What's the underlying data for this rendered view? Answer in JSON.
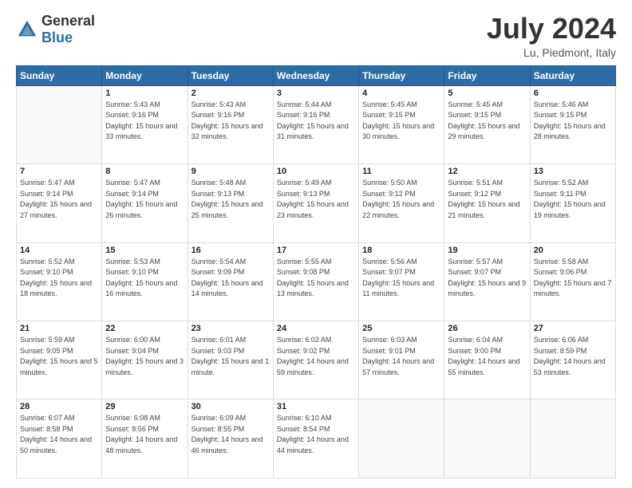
{
  "logo": {
    "general": "General",
    "blue": "Blue"
  },
  "title": {
    "month": "July 2024",
    "location": "Lu, Piedmont, Italy"
  },
  "weekdays": [
    "Sunday",
    "Monday",
    "Tuesday",
    "Wednesday",
    "Thursday",
    "Friday",
    "Saturday"
  ],
  "weeks": [
    [
      {
        "day": "",
        "sunrise": "",
        "sunset": "",
        "daylight": ""
      },
      {
        "day": "1",
        "sunrise": "Sunrise: 5:43 AM",
        "sunset": "Sunset: 9:16 PM",
        "daylight": "Daylight: 15 hours and 33 minutes."
      },
      {
        "day": "2",
        "sunrise": "Sunrise: 5:43 AM",
        "sunset": "Sunset: 9:16 PM",
        "daylight": "Daylight: 15 hours and 32 minutes."
      },
      {
        "day": "3",
        "sunrise": "Sunrise: 5:44 AM",
        "sunset": "Sunset: 9:16 PM",
        "daylight": "Daylight: 15 hours and 31 minutes."
      },
      {
        "day": "4",
        "sunrise": "Sunrise: 5:45 AM",
        "sunset": "Sunset: 9:15 PM",
        "daylight": "Daylight: 15 hours and 30 minutes."
      },
      {
        "day": "5",
        "sunrise": "Sunrise: 5:45 AM",
        "sunset": "Sunset: 9:15 PM",
        "daylight": "Daylight: 15 hours and 29 minutes."
      },
      {
        "day": "6",
        "sunrise": "Sunrise: 5:46 AM",
        "sunset": "Sunset: 9:15 PM",
        "daylight": "Daylight: 15 hours and 28 minutes."
      }
    ],
    [
      {
        "day": "7",
        "sunrise": "Sunrise: 5:47 AM",
        "sunset": "Sunset: 9:14 PM",
        "daylight": "Daylight: 15 hours and 27 minutes."
      },
      {
        "day": "8",
        "sunrise": "Sunrise: 5:47 AM",
        "sunset": "Sunset: 9:14 PM",
        "daylight": "Daylight: 15 hours and 26 minutes."
      },
      {
        "day": "9",
        "sunrise": "Sunrise: 5:48 AM",
        "sunset": "Sunset: 9:13 PM",
        "daylight": "Daylight: 15 hours and 25 minutes."
      },
      {
        "day": "10",
        "sunrise": "Sunrise: 5:49 AM",
        "sunset": "Sunset: 9:13 PM",
        "daylight": "Daylight: 15 hours and 23 minutes."
      },
      {
        "day": "11",
        "sunrise": "Sunrise: 5:50 AM",
        "sunset": "Sunset: 9:12 PM",
        "daylight": "Daylight: 15 hours and 22 minutes."
      },
      {
        "day": "12",
        "sunrise": "Sunrise: 5:51 AM",
        "sunset": "Sunset: 9:12 PM",
        "daylight": "Daylight: 15 hours and 21 minutes."
      },
      {
        "day": "13",
        "sunrise": "Sunrise: 5:52 AM",
        "sunset": "Sunset: 9:11 PM",
        "daylight": "Daylight: 15 hours and 19 minutes."
      }
    ],
    [
      {
        "day": "14",
        "sunrise": "Sunrise: 5:52 AM",
        "sunset": "Sunset: 9:10 PM",
        "daylight": "Daylight: 15 hours and 18 minutes."
      },
      {
        "day": "15",
        "sunrise": "Sunrise: 5:53 AM",
        "sunset": "Sunset: 9:10 PM",
        "daylight": "Daylight: 15 hours and 16 minutes."
      },
      {
        "day": "16",
        "sunrise": "Sunrise: 5:54 AM",
        "sunset": "Sunset: 9:09 PM",
        "daylight": "Daylight: 15 hours and 14 minutes."
      },
      {
        "day": "17",
        "sunrise": "Sunrise: 5:55 AM",
        "sunset": "Sunset: 9:08 PM",
        "daylight": "Daylight: 15 hours and 13 minutes."
      },
      {
        "day": "18",
        "sunrise": "Sunrise: 5:56 AM",
        "sunset": "Sunset: 9:07 PM",
        "daylight": "Daylight: 15 hours and 11 minutes."
      },
      {
        "day": "19",
        "sunrise": "Sunrise: 5:57 AM",
        "sunset": "Sunset: 9:07 PM",
        "daylight": "Daylight: 15 hours and 9 minutes."
      },
      {
        "day": "20",
        "sunrise": "Sunrise: 5:58 AM",
        "sunset": "Sunset: 9:06 PM",
        "daylight": "Daylight: 15 hours and 7 minutes."
      }
    ],
    [
      {
        "day": "21",
        "sunrise": "Sunrise: 5:59 AM",
        "sunset": "Sunset: 9:05 PM",
        "daylight": "Daylight: 15 hours and 5 minutes."
      },
      {
        "day": "22",
        "sunrise": "Sunrise: 6:00 AM",
        "sunset": "Sunset: 9:04 PM",
        "daylight": "Daylight: 15 hours and 3 minutes."
      },
      {
        "day": "23",
        "sunrise": "Sunrise: 6:01 AM",
        "sunset": "Sunset: 9:03 PM",
        "daylight": "Daylight: 15 hours and 1 minute."
      },
      {
        "day": "24",
        "sunrise": "Sunrise: 6:02 AM",
        "sunset": "Sunset: 9:02 PM",
        "daylight": "Daylight: 14 hours and 59 minutes."
      },
      {
        "day": "25",
        "sunrise": "Sunrise: 6:03 AM",
        "sunset": "Sunset: 9:01 PM",
        "daylight": "Daylight: 14 hours and 57 minutes."
      },
      {
        "day": "26",
        "sunrise": "Sunrise: 6:04 AM",
        "sunset": "Sunset: 9:00 PM",
        "daylight": "Daylight: 14 hours and 55 minutes."
      },
      {
        "day": "27",
        "sunrise": "Sunrise: 6:06 AM",
        "sunset": "Sunset: 8:59 PM",
        "daylight": "Daylight: 14 hours and 53 minutes."
      }
    ],
    [
      {
        "day": "28",
        "sunrise": "Sunrise: 6:07 AM",
        "sunset": "Sunset: 8:58 PM",
        "daylight": "Daylight: 14 hours and 50 minutes."
      },
      {
        "day": "29",
        "sunrise": "Sunrise: 6:08 AM",
        "sunset": "Sunset: 8:56 PM",
        "daylight": "Daylight: 14 hours and 48 minutes."
      },
      {
        "day": "30",
        "sunrise": "Sunrise: 6:09 AM",
        "sunset": "Sunset: 8:55 PM",
        "daylight": "Daylight: 14 hours and 46 minutes."
      },
      {
        "day": "31",
        "sunrise": "Sunrise: 6:10 AM",
        "sunset": "Sunset: 8:54 PM",
        "daylight": "Daylight: 14 hours and 44 minutes."
      },
      {
        "day": "",
        "sunrise": "",
        "sunset": "",
        "daylight": ""
      },
      {
        "day": "",
        "sunrise": "",
        "sunset": "",
        "daylight": ""
      },
      {
        "day": "",
        "sunrise": "",
        "sunset": "",
        "daylight": ""
      }
    ]
  ]
}
